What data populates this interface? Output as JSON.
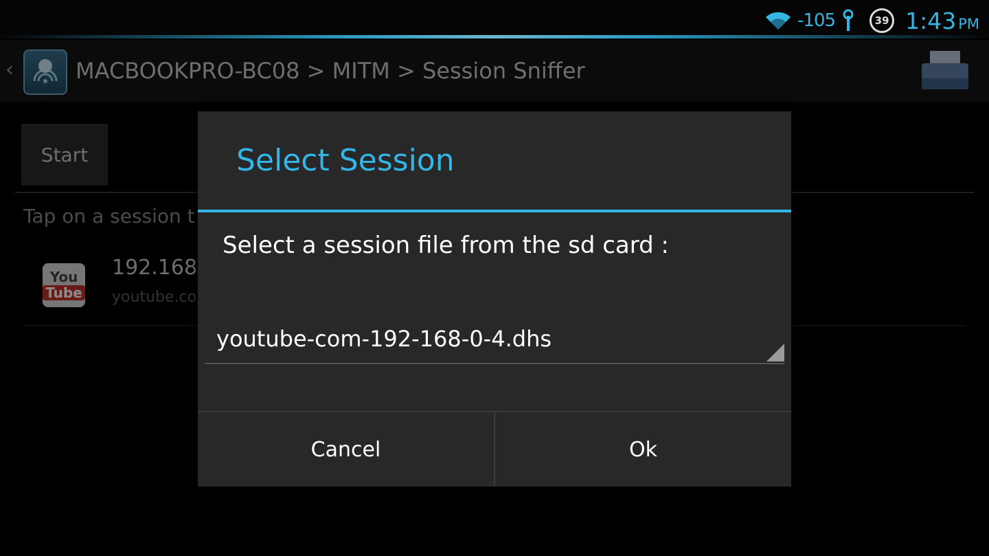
{
  "status_bar": {
    "signal_text": "-105",
    "notification_count": "39",
    "time": "1:43",
    "ampm": "PM",
    "accent_color": "#33b5e5"
  },
  "action_bar": {
    "breadcrumb": "MACBOOKPRO-BC08 > MITM > Session Sniffer",
    "icons": [
      "up-caret-icon",
      "app-icon",
      "print-icon"
    ]
  },
  "content": {
    "start_label": "Start",
    "hint_text": "Tap on a session t",
    "session_row": {
      "title": "192.168",
      "subtitle": "youtube.co",
      "icon_top": "You",
      "icon_bottom": "Tube"
    }
  },
  "dialog": {
    "title": "Select Session",
    "message": "Select a session file from the sd card :",
    "selected_file": "youtube-com-192-168-0-4.dhs",
    "cancel_label": "Cancel",
    "ok_label": "Ok"
  }
}
